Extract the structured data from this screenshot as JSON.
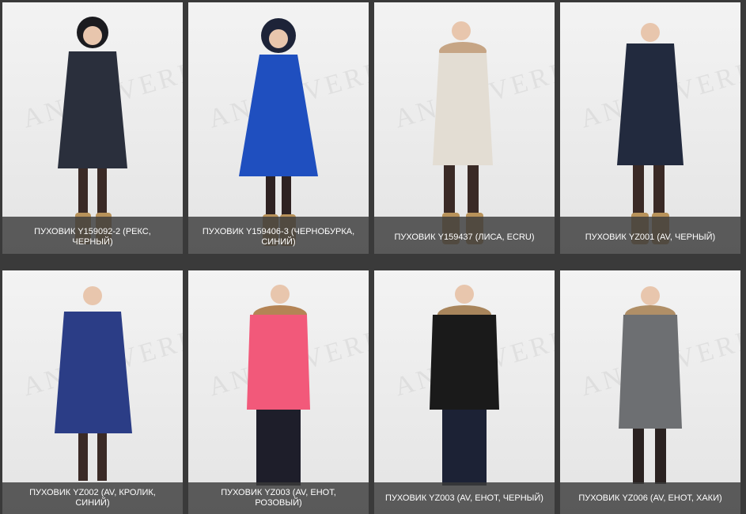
{
  "products": [
    {
      "name": "ПУХОВИК Y159092-2 (РЕКС, ЧЕРНЫЙ)",
      "coat_color": "#2a2f3c",
      "fur_color": "#1b1b1f",
      "watermark": "ANNA VERDI"
    },
    {
      "name": "ПУХОВИК Y159406-3 (ЧЕРНОБУРКА, СИНИЙ)",
      "coat_color": "#1f4fbf",
      "fur_color": "#1d2338",
      "watermark": "ANNA VERDI"
    },
    {
      "name": "ПУХОВИК Y159437 (ЛИСА, ECRU)",
      "coat_color": "#e3ddd3",
      "fur_color": "#c6a585",
      "watermark": "ANNA VERDI"
    },
    {
      "name": "ПУХОВИК YZ001 (AV, ЧЕРНЫЙ)",
      "coat_color": "#222a3e",
      "fur_color": "#222a3e",
      "watermark": "ANNA VERDI"
    },
    {
      "name": "ПУХОВИК YZ002 (AV, КРОЛИК, СИНИЙ)",
      "coat_color": "#2b3d86",
      "fur_color": "#22306b",
      "watermark": "ANNA VERDI"
    },
    {
      "name": "ПУХОВИК YZ003 (AV, ЕНОТ, РОЗОВЫЙ)",
      "coat_color": "#f2597a",
      "fur_color": "#b48455",
      "watermark": "ANNA VERDI"
    },
    {
      "name": "ПУХОВИК YZ003 (AV, ЕНОТ, ЧЕРНЫЙ)",
      "coat_color": "#1a1a1a",
      "fur_color": "#a8855c",
      "watermark": "ANNA VERDI"
    },
    {
      "name": "ПУХОВИК YZ006 (AV, ЕНОТ, ХАКИ)",
      "coat_color": "#6d6f72",
      "fur_color": "#b08f67",
      "watermark": "ANNA VERDI"
    }
  ]
}
